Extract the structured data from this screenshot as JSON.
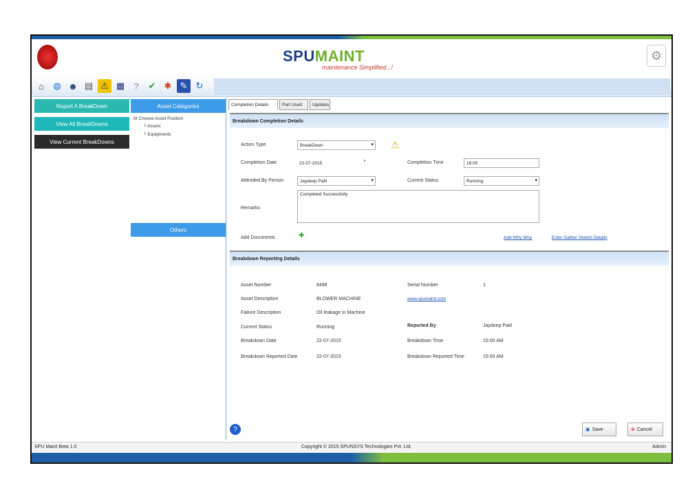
{
  "header": {
    "logo_part1": "SPU",
    "logo_part2": "MAINT",
    "tagline": "maintenance Simplified...!"
  },
  "toolbar": {
    "icons": [
      "home-icon",
      "globe-icon",
      "user-icon",
      "document-icon",
      "warning-icon",
      "book-icon",
      "help-icon",
      "check-icon",
      "tools-icon",
      "wrench-icon",
      "refresh-icon"
    ]
  },
  "left_menu": {
    "items": [
      "Report A BreakDown",
      "View All BreakDowns",
      "View Current BreakDowns"
    ]
  },
  "tree": {
    "heading": "Asset Categories",
    "root": "Choose Asset Position",
    "children": [
      "Assets",
      "Equipments"
    ],
    "section2": "Others"
  },
  "tabs": [
    "Completion Details",
    "Part Used",
    "Updates"
  ],
  "completion": {
    "heading": "Breakdown Completion Details",
    "fields": {
      "action_type_label": "Action Type",
      "action_type_value": "BreakDown",
      "completion_date_label": "Completion Date",
      "completion_date_value": "22-07-2015",
      "completion_time_label": "Completion Time",
      "completion_time_value": "16:05",
      "attended_label": "Attended By Person",
      "attended_value": "Jaydeep Patil",
      "current_status_label": "Current Status",
      "current_status_value": "Running",
      "remarks_label": "Remarks",
      "remarks_value": "Completed Successfully",
      "add_docs_label": "Add Documents"
    },
    "links": [
      "Add Why Why",
      "Enter Gather Sketch Details"
    ]
  },
  "reporting": {
    "heading": "Breakdown Reporting Details",
    "left": [
      {
        "label": "Asset Number",
        "value": "8498"
      },
      {
        "label": "Asset Description",
        "value": "BLOWER MACHINE"
      },
      {
        "label": "Failure Description",
        "value": "Oil leakage in Machine"
      },
      {
        "label": "Current Status",
        "value": "Running"
      },
      {
        "label": "Breakdown Date",
        "value": "22-07-2015"
      },
      {
        "label": "Breakdown Reported Date",
        "value": "22-07-2015"
      }
    ],
    "right": [
      {
        "label": "Serial Number",
        "value": "1",
        "link": false
      },
      {
        "label": "",
        "value": "www.spumaint.com",
        "link": true
      },
      {
        "label": "Reported By",
        "value": "Jaydeep Patil",
        "link": false
      },
      {
        "label": "Breakdown Time",
        "value": "15:00 AM",
        "link": false
      },
      {
        "label": "Breakdown Reported Time",
        "value": "15:00 AM",
        "link": false
      }
    ]
  },
  "buttons": {
    "save": "Save",
    "cancel": "Cancel"
  },
  "footer": {
    "left": "SPU Maint Beta 1.0",
    "center": "Copyright © 2015 SPUNSYS Technologies Pvt. Ltd.",
    "right": "Admin"
  }
}
